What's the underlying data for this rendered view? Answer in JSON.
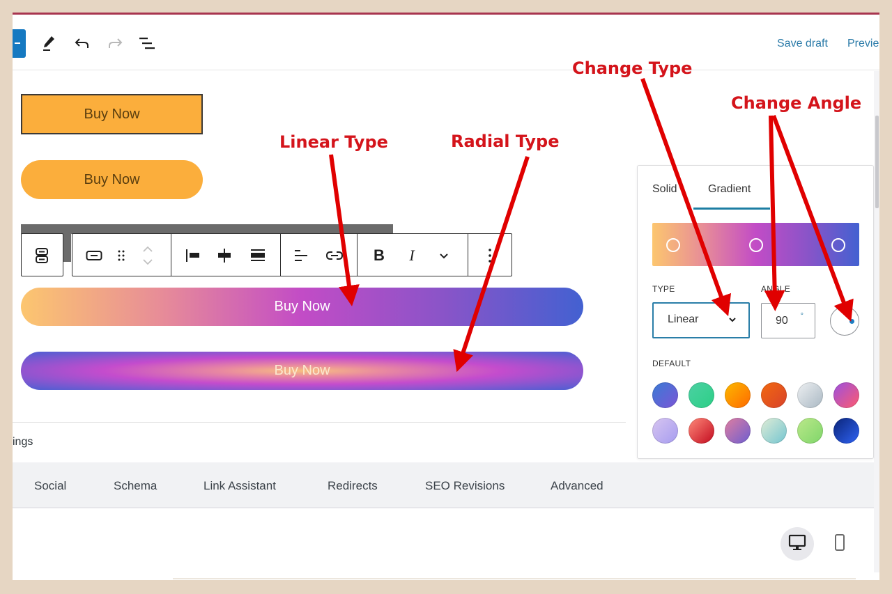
{
  "toolbar": {
    "icons": [
      "block-inserter",
      "edit-pencil",
      "undo",
      "redo",
      "document-outline"
    ],
    "save_draft": "Save draft",
    "preview": "Previe"
  },
  "buttons": [
    {
      "label": "Buy Now",
      "style": "rectangle-bordered",
      "color": "#fbae3c"
    },
    {
      "label": "Buy Now",
      "style": "pill",
      "color": "#fbae3c"
    },
    {
      "label": "Buy Now",
      "style": "linear-gradient"
    },
    {
      "label": "Buy Now",
      "style": "radial-gradient"
    }
  ],
  "block_toolbar": {
    "icons": [
      "select-parent",
      "button-block",
      "drag-handle",
      "move-up-down",
      "justify-left",
      "justify-center",
      "justify-stretch",
      "text-align",
      "link",
      "bold",
      "italic",
      "more-rich-text",
      "options"
    ],
    "bold_label": "B",
    "italic_label": "I"
  },
  "gradient_panel": {
    "tabs": [
      {
        "label": "Solid",
        "active": false
      },
      {
        "label": "Gradient",
        "active": true
      }
    ],
    "gradient_stops": [
      {
        "color": "#fcc66f",
        "position": 0.1
      },
      {
        "color": "#c24cc6",
        "position": 0.5
      },
      {
        "color": "#4361d1",
        "position": 0.9
      }
    ],
    "type_label": "TYPE",
    "type_value": "Linear",
    "angle_label": "ANGLE",
    "angle_value": "90",
    "angle_unit": "°",
    "default_label": "DEFAULT",
    "presets": [
      {
        "name": "vivid-cyan-blue-to-purple",
        "from": "#3a7bd5",
        "to": "#7b55d6"
      },
      {
        "name": "light-green-cyan",
        "from": "#4cd0a3",
        "to": "#2ccf86"
      },
      {
        "name": "luminous-vivid-amber",
        "from": "#fcb900",
        "to": "#ff6900"
      },
      {
        "name": "luminous-orange-to-red",
        "from": "#f2690f",
        "to": "#d8422b"
      },
      {
        "name": "cool-gray",
        "from": "#eef0f2",
        "to": "#a9b8c3"
      },
      {
        "name": "purple-to-pink",
        "from": "#9b51e0",
        "to": "#ff5a6e"
      },
      {
        "name": "lavender",
        "from": "#d7c5f0",
        "to": "#a69cf0"
      },
      {
        "name": "red-gradient",
        "from": "#ff8a7a",
        "to": "#c20a1e"
      },
      {
        "name": "orchid",
        "from": "#e07ea0",
        "to": "#6d5ed0"
      },
      {
        "name": "mint",
        "from": "#e0ecd6",
        "to": "#73c5d0"
      },
      {
        "name": "light-green",
        "from": "#bbe88a",
        "to": "#7fd66a"
      },
      {
        "name": "deep-blue",
        "from": "#0a2478",
        "to": "#2f63f4"
      }
    ]
  },
  "settings": {
    "label_partial": "ings"
  },
  "seo_tabs": [
    "Social",
    "Schema",
    "Link Assistant",
    "Redirects",
    "SEO Revisions",
    "Advanced"
  ],
  "device_preview": {
    "desktop": "desktop-icon",
    "mobile": "mobile-icon",
    "active": "desktop"
  },
  "annotations": {
    "linear": "Linear Type",
    "radial": "Radial Type",
    "change_type": "Change Type",
    "change_angle": "Change Angle",
    "color": "#d4141b"
  }
}
